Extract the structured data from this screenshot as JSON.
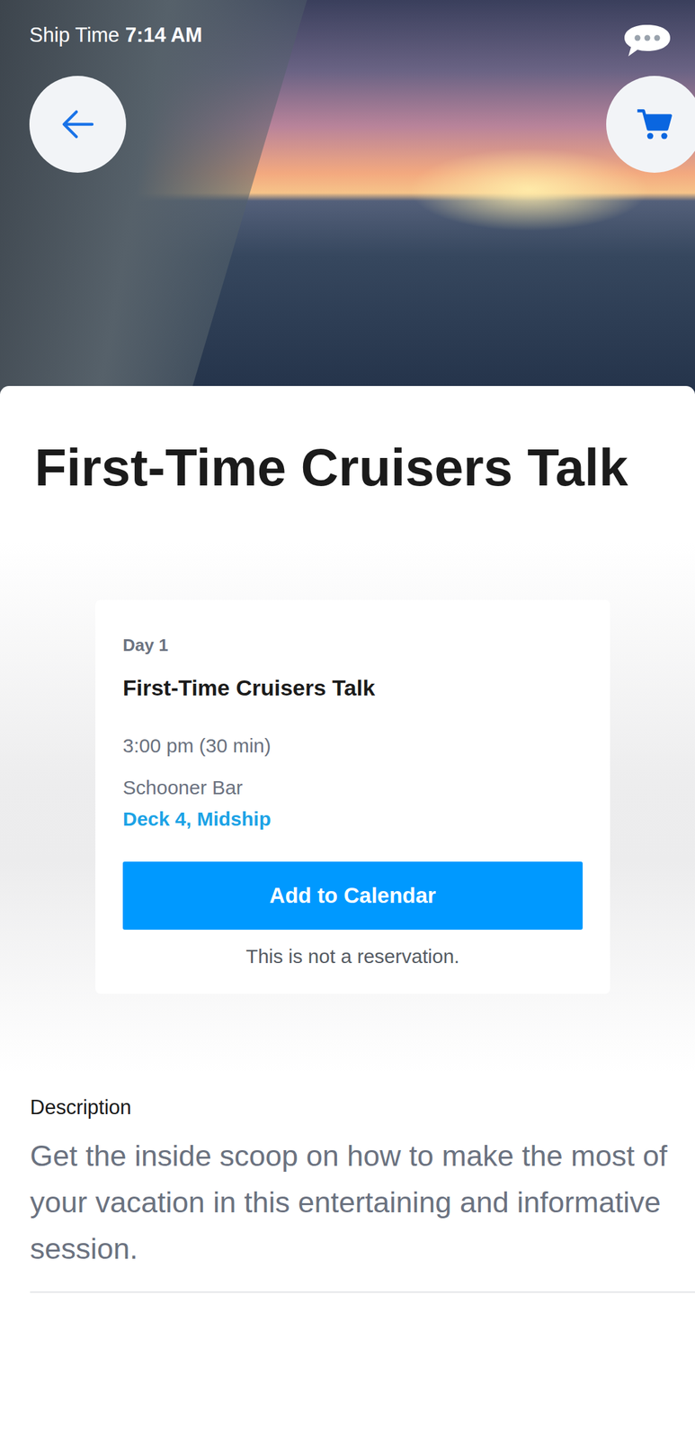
{
  "status": {
    "label": "Ship Time",
    "time": "7:14 AM"
  },
  "title": "First-Time Cruisers Talk",
  "event": {
    "day": "Day 1",
    "title": "First-Time Cruisers Talk",
    "time": "3:00 pm (30 min)",
    "venue": "Schooner Bar",
    "location": "Deck 4, Midship",
    "button": "Add to Calendar",
    "note": "This is not a reservation."
  },
  "description": {
    "label": "Description",
    "text": "Get the inside scoop on how to make the most of your vacation in this entertaining and informative session."
  }
}
